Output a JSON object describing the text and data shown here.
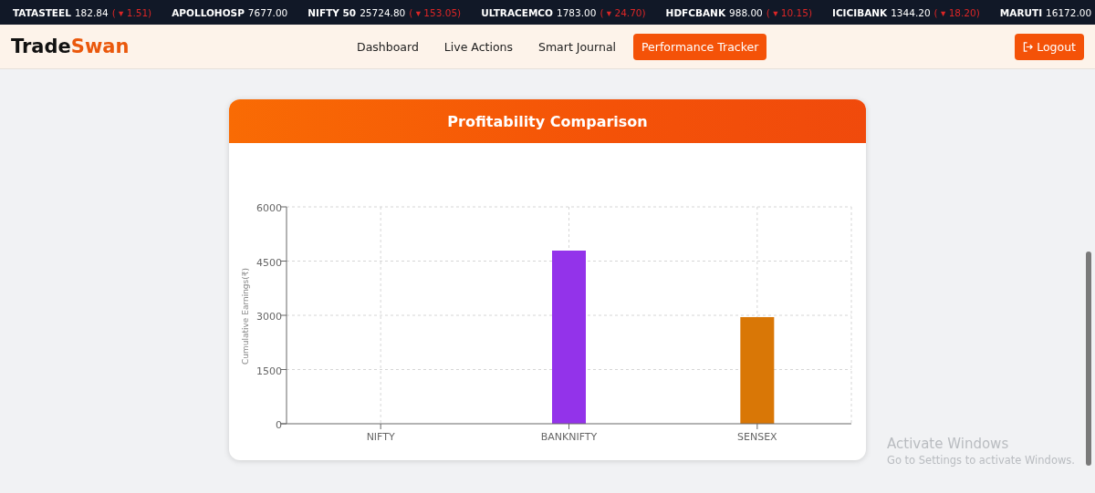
{
  "ticker": [
    {
      "symbol": "TATASTEEL",
      "price": "182.84",
      "change": "( ▾ 1.51)"
    },
    {
      "symbol": "APOLLOHOSP",
      "price": "7677.00"
    },
    {
      "symbol": "NIFTY 50",
      "price": "25724.80",
      "change": "( ▾ 153.05)"
    },
    {
      "symbol": "ULTRACEMCO",
      "price": "1783.00",
      "change": "( ▾ 24.70)"
    },
    {
      "symbol": "HDFCBANK",
      "price": "988.00",
      "change": "( ▾ 10.15)"
    },
    {
      "symbol": "ICICIBANK",
      "price": "1344.20",
      "change": "( ▾ 18.20)"
    },
    {
      "symbol": "MARUTI",
      "price": "16172.00"
    }
  ],
  "brand": {
    "first": "Trade",
    "second": "Swan"
  },
  "nav": [
    {
      "label": "Dashboard",
      "selected": false
    },
    {
      "label": "Live Actions",
      "selected": false
    },
    {
      "label": "Smart Journal",
      "selected": false
    },
    {
      "label": "Performance Tracker",
      "selected": true
    }
  ],
  "logout": "Logout",
  "card": {
    "title": "Profitability Comparison",
    "chart_data": {
      "type": "bar",
      "ylabel": "Cumulative Earnings(₹)",
      "categories": [
        "NIFTY",
        "BANKNIFTY",
        "SENSEX"
      ],
      "series": [
        {
          "color": "#9333ea",
          "values": [
            0,
            4790,
            null
          ]
        },
        {
          "color": "#d97706",
          "values": [
            null,
            null,
            2950
          ]
        }
      ],
      "grid": true,
      "ylim": [
        0,
        6000
      ],
      "yticks": [
        0,
        1500,
        3000,
        4500,
        6000
      ]
    }
  },
  "os_notice": {
    "title": "Activate Windows",
    "text": "Go to Settings to activate Windows."
  }
}
